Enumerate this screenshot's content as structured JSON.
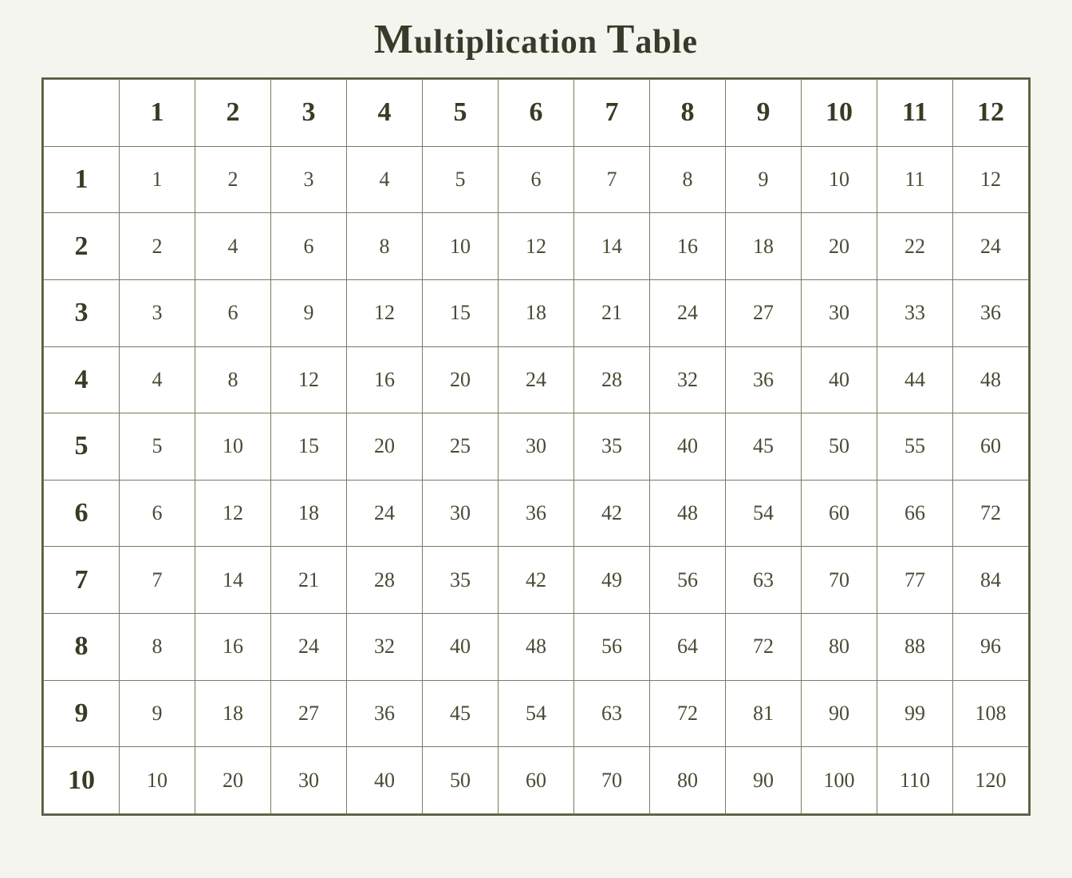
{
  "title": "Multiplication Table",
  "headers": [
    "",
    "1",
    "2",
    "3",
    "4",
    "5",
    "6",
    "7",
    "8",
    "9",
    "10",
    "11",
    "12"
  ],
  "rows": [
    {
      "label": "1",
      "values": [
        1,
        2,
        3,
        4,
        5,
        6,
        7,
        8,
        9,
        10,
        11,
        12
      ]
    },
    {
      "label": "2",
      "values": [
        2,
        4,
        6,
        8,
        10,
        12,
        14,
        16,
        18,
        20,
        22,
        24
      ]
    },
    {
      "label": "3",
      "values": [
        3,
        6,
        9,
        12,
        15,
        18,
        21,
        24,
        27,
        30,
        33,
        36
      ]
    },
    {
      "label": "4",
      "values": [
        4,
        8,
        12,
        16,
        20,
        24,
        28,
        32,
        36,
        40,
        44,
        48
      ]
    },
    {
      "label": "5",
      "values": [
        5,
        10,
        15,
        20,
        25,
        30,
        35,
        40,
        45,
        50,
        55,
        60
      ]
    },
    {
      "label": "6",
      "values": [
        6,
        12,
        18,
        24,
        30,
        36,
        42,
        48,
        54,
        60,
        66,
        72
      ]
    },
    {
      "label": "7",
      "values": [
        7,
        14,
        21,
        28,
        35,
        42,
        49,
        56,
        63,
        70,
        77,
        84
      ]
    },
    {
      "label": "8",
      "values": [
        8,
        16,
        24,
        32,
        40,
        48,
        56,
        64,
        72,
        80,
        88,
        96
      ]
    },
    {
      "label": "9",
      "values": [
        9,
        18,
        27,
        36,
        45,
        54,
        63,
        72,
        81,
        90,
        99,
        108
      ]
    },
    {
      "label": "10",
      "values": [
        10,
        20,
        30,
        40,
        50,
        60,
        70,
        80,
        90,
        100,
        110,
        120
      ]
    }
  ]
}
